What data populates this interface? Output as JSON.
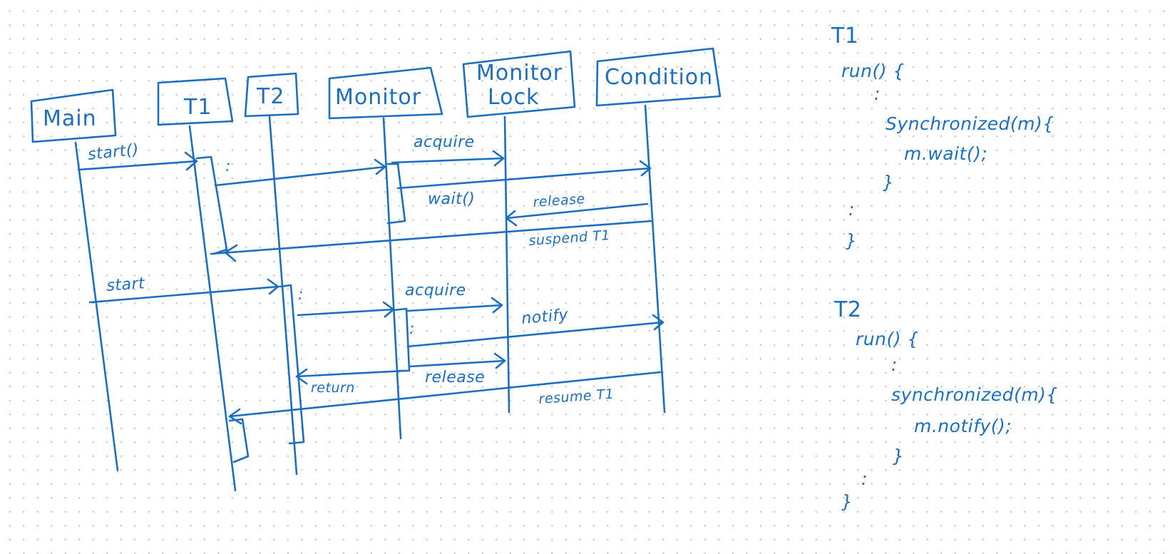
{
  "diagram": {
    "participants": {
      "main": "Main",
      "t1": "T1",
      "t2": "T2",
      "monitor": "Monitor",
      "monitor_lock_line1": "Monitor",
      "monitor_lock_line2": "Lock",
      "condition": "Condition"
    },
    "messages": {
      "start_t1": "start()",
      "acquire_1": "acquire",
      "wait": "wait()",
      "release_1": "release",
      "suspend": "suspend T1",
      "start_t2": "start",
      "acquire_2": "acquire",
      "notify": "notify",
      "release_2": "release",
      "return": "return",
      "resume": "resume T1"
    },
    "ellipsis": ":"
  },
  "code": {
    "t1": {
      "title": "T1",
      "lines": [
        "run() {",
        ":",
        "Synchronized(m){",
        "m.wait();",
        "}",
        ":",
        "}"
      ]
    },
    "t2": {
      "title": "T2",
      "lines": [
        "run() {",
        ":",
        "synchronized(m){",
        "m.notify();",
        "}",
        ":",
        "}"
      ]
    }
  },
  "colors": {
    "ink": "#1c6fc0",
    "background": "#ffffff",
    "grid_dots": "#c9c9c9"
  }
}
